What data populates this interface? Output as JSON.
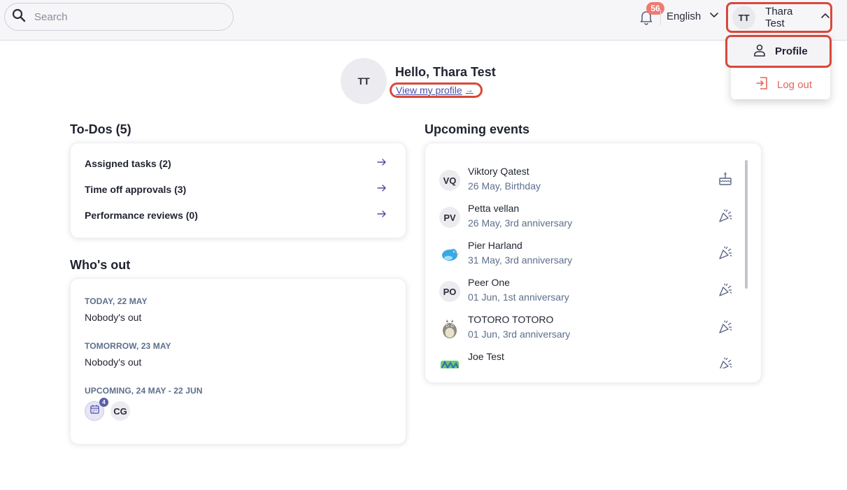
{
  "search": {
    "placeholder": "Search"
  },
  "header": {
    "notification_count": "56",
    "language": "English",
    "user_initials": "TT",
    "user_name": "Thara Test"
  },
  "user_menu": {
    "profile_label": "Profile",
    "logout_label": "Log out"
  },
  "greeting": {
    "avatar_initials": "TT",
    "hello": "Hello, Thara Test",
    "view_profile": "View my profile"
  },
  "todos": {
    "title": "To-Dos (5)",
    "items": [
      {
        "label": "Assigned tasks (2)"
      },
      {
        "label": "Time off approvals (3)"
      },
      {
        "label": "Performance reviews (0)"
      }
    ]
  },
  "whos_out": {
    "title": "Who's out",
    "today_heading": "TODAY, 22 MAY",
    "today_text": "Nobody's out",
    "tomorrow_heading": "TOMORROW, 23 MAY",
    "tomorrow_text": "Nobody's out",
    "upcoming_heading": "UPCOMING, 24 MAY - 22 JUN",
    "calendar_badge": "4",
    "upcoming_avatar": "CG"
  },
  "events": {
    "title": "Upcoming events",
    "items": [
      {
        "initials": "VQ",
        "name": "Viktory Qatest",
        "detail": "26 May, Birthday",
        "icon": "cake-icon"
      },
      {
        "initials": "PV",
        "name": "Petta vellan",
        "detail": "26 May, 3rd anniversary",
        "icon": "party-popper-icon"
      },
      {
        "initials": "",
        "name": "Pier Harland",
        "detail": "31 May, 3rd anniversary",
        "icon": "party-popper-icon",
        "avatar": "bird-avatar"
      },
      {
        "initials": "PO",
        "name": "Peer One",
        "detail": "01 Jun, 1st anniversary",
        "icon": "party-popper-icon"
      },
      {
        "initials": "",
        "name": "TOTORO TOTORO",
        "detail": "01 Jun, 3rd anniversary",
        "icon": "party-popper-icon",
        "avatar": "totoro-avatar"
      },
      {
        "initials": "",
        "name": "Joe Test",
        "detail": "",
        "icon": "party-popper-icon",
        "avatar": "sticker-avatar"
      }
    ]
  },
  "colors": {
    "accent": "#4b4fa8",
    "badge": "#f07a70",
    "highlight": "#d9483b",
    "logout": "#e2685c",
    "muted": "#5d6f8c"
  }
}
